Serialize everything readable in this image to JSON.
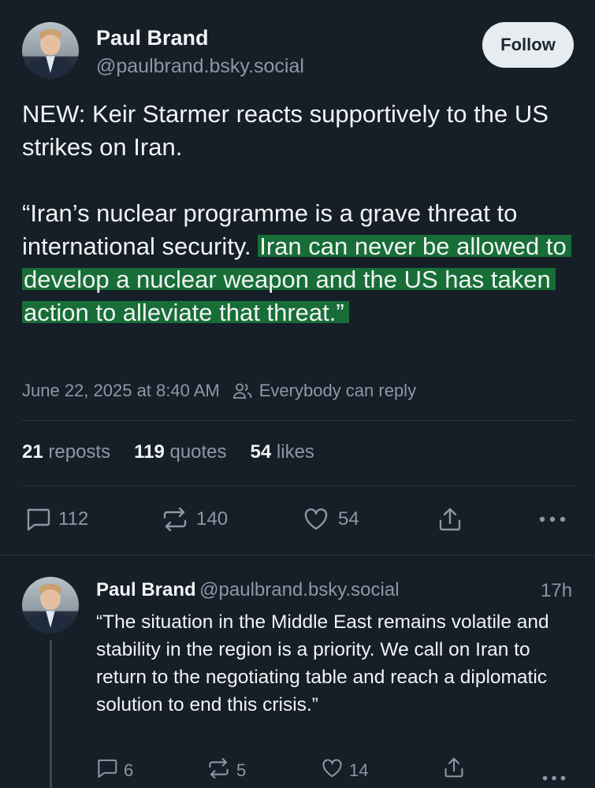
{
  "post": {
    "author_name": "Paul Brand",
    "author_handle": "@paulbrand.bsky.social",
    "follow_label": "Follow",
    "text_line1": "NEW: Keir Starmer reacts supportively to the US strikes on Iran.",
    "quote_plain": "“Iran’s nuclear programme is a grave threat to international security. ",
    "quote_highlighted": "Iran can never be allowed to develop a nuclear weapon and the US has taken action to alleviate that threat.”",
    "timestamp": "June 22, 2025 at 8:40 AM",
    "reply_setting": "Everybody can reply",
    "highlight_color": "#188c3c"
  },
  "stats": {
    "reposts_count": "21",
    "reposts_label": "reposts",
    "quotes_count": "119",
    "quotes_label": "quotes",
    "likes_count": "54",
    "likes_label": "likes"
  },
  "actions": {
    "replies": "112",
    "reposts": "140",
    "likes": "54"
  },
  "reply": {
    "author_name": "Paul Brand",
    "author_handle": "@paulbrand.bsky.social",
    "time": "17h",
    "text": "“The situation in the Middle East remains volatile and stability in the region is a priority. We call on Iran to return to the negotiating table and reach a diplomatic solution to end this crisis.”",
    "replies": "6",
    "reposts": "5",
    "likes": "14"
  },
  "icons": {
    "reply": "speech-bubble-icon",
    "repost": "repost-arrows-icon",
    "like": "heart-icon",
    "share": "share-upload-icon",
    "more": "ellipsis-icon",
    "reply_setting": "people-icon"
  },
  "colors": {
    "background": "#161e27",
    "text": "#f1f3f5",
    "muted": "#8b98a5",
    "follow_bg": "#e7ecf0"
  }
}
